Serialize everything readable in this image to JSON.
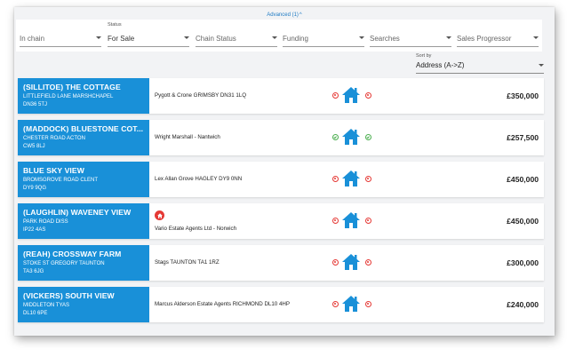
{
  "advanced": {
    "label": "Advanced (1)"
  },
  "filters": [
    {
      "label": "",
      "value": "In chain",
      "placeholder": true
    },
    {
      "label": "Status",
      "value": "For Sale",
      "placeholder": false
    },
    {
      "label": "",
      "value": "Chain Status",
      "placeholder": true
    },
    {
      "label": "",
      "value": "Funding",
      "placeholder": true
    },
    {
      "label": "",
      "value": "Searches",
      "placeholder": true
    },
    {
      "label": "",
      "value": "Sales Progressor",
      "placeholder": true
    }
  ],
  "sort": {
    "label": "Sort by",
    "value": "Address (A->Z)"
  },
  "colors": {
    "accent": "#1990d8",
    "bad": "#e53935",
    "good": "#4caf50",
    "agent_logo": "#e53935"
  },
  "listings": [
    {
      "title": "(SILLITOE) THE COTTAGE",
      "line1": "LITTLEFIELD LANE MARSHCHAPEL",
      "line2": "DN36 5TJ",
      "agent": "Pygott & Crone GRIMSBY DN31 1LQ",
      "status": "red",
      "price": "£350,000"
    },
    {
      "title": "(MADDOCK) BLUESTONE COT...",
      "line1": "CHESTER ROAD ACTON",
      "line2": "CW5 8LJ",
      "agent": "Wright Marshall - Nantwich",
      "status": "green",
      "price": "£257,500"
    },
    {
      "title": "BLUE SKY VIEW",
      "line1": "BROMSGROVE ROAD CLENT",
      "line2": "DY9 9QG",
      "agent": "Lex Allan Grove HAGLEY DY9 0NN",
      "status": "red",
      "price": "£450,000"
    },
    {
      "title": "(LAUGHLIN) WAVENEY VIEW",
      "line1": "PARK ROAD DISS",
      "line2": "IP22 4AS",
      "agent": "Vario Estate Agents Ltd - Norwich",
      "status": "red",
      "price": "£450,000",
      "agent_logo": true
    },
    {
      "title": "(REAH) CROSSWAY FARM",
      "line1": "STOKE ST GREGORY TAUNTON",
      "line2": "TA3 6JG",
      "agent": "Stags TAUNTON TA1 1RZ",
      "status": "red",
      "price": "£300,000"
    },
    {
      "title": "(VICKERS) SOUTH VIEW",
      "line1": "MIDDLETON TYAS",
      "line2": "DL10 6PE",
      "agent": "Marcus Alderson Estate Agents RICHMOND DL10 4HP",
      "status": "red",
      "price": "£240,000"
    }
  ],
  "icons": {
    "status_indicator": "circle-status-icon",
    "property": "house-icon",
    "dropdown": "chevron-down-icon"
  }
}
